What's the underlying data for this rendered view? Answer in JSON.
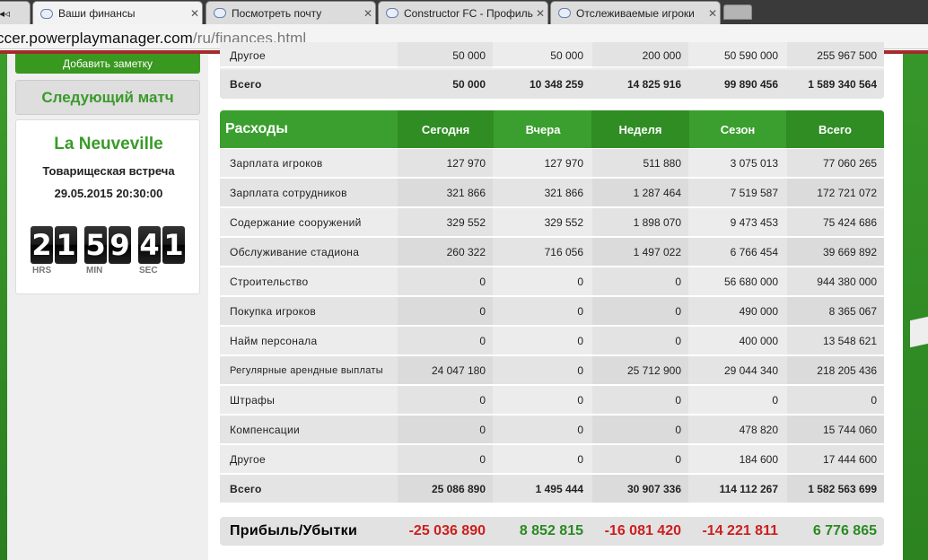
{
  "browser": {
    "tabs": [
      {
        "label": "Ваши финансы",
        "active": true
      },
      {
        "label": "Посмотреть почту",
        "active": false
      },
      {
        "label": "Constructor FC - Профиль",
        "active": false
      },
      {
        "label": "Отслеживаемые игроки",
        "active": false
      }
    ],
    "url_main": "ccer.powerplaymanager.com",
    "url_path": "/ru/finances.html"
  },
  "sidebar": {
    "add_note": "Добавить заметку",
    "next_match_title": "Следующий матч",
    "team": "La Neuveville",
    "match_type": "Товарищеская встреча",
    "match_date": "29.05.2015 20:30:00",
    "countdown": {
      "hours": [
        "2",
        "1"
      ],
      "minutes": [
        "5",
        "9"
      ],
      "seconds": [
        "4",
        "1"
      ],
      "hrs_label": "HRS",
      "min_label": "MIN",
      "sec_label": "SEC"
    }
  },
  "income_tail": {
    "other": {
      "label": "Другое",
      "values": [
        "50 000",
        "50 000",
        "200 000",
        "50 590 000",
        "255 967 500"
      ]
    },
    "total": {
      "label": "Всего",
      "values": [
        "50 000",
        "10 348 259",
        "14 825 916",
        "99 890 456",
        "1 589 340 564"
      ]
    }
  },
  "expenses": {
    "title": "Расходы",
    "columns": [
      "Сегодня",
      "Вчера",
      "Неделя",
      "Сезон",
      "Всего"
    ],
    "rows": [
      {
        "label": "Зарплата игроков",
        "values": [
          "127 970",
          "127 970",
          "511 880",
          "3 075 013",
          "77 060 265"
        ]
      },
      {
        "label": "Зарплата сотрудников",
        "values": [
          "321 866",
          "321 866",
          "1 287 464",
          "7 519 587",
          "172 721 072"
        ]
      },
      {
        "label": "Содержание сооружений",
        "values": [
          "329 552",
          "329 552",
          "1 898 070",
          "9 473 453",
          "75 424 686"
        ]
      },
      {
        "label": "Обслуживание стадиона",
        "values": [
          "260 322",
          "716 056",
          "1 497 022",
          "6 766 454",
          "39 669 892"
        ]
      },
      {
        "label": "Строительство",
        "values": [
          "0",
          "0",
          "0",
          "56 680 000",
          "944 380 000"
        ]
      },
      {
        "label": "Покупка игроков",
        "values": [
          "0",
          "0",
          "0",
          "490 000",
          "8 365 067"
        ]
      },
      {
        "label": "Найм персонала",
        "values": [
          "0",
          "0",
          "0",
          "400 000",
          "13 548 621"
        ]
      },
      {
        "label": "Регулярные арендные выплаты",
        "values": [
          "24 047 180",
          "0",
          "25 712 900",
          "29 044 340",
          "218 205 436"
        ]
      },
      {
        "label": "Штрафы",
        "values": [
          "0",
          "0",
          "0",
          "0",
          "0"
        ]
      },
      {
        "label": "Компенсации",
        "values": [
          "0",
          "0",
          "0",
          "478 820",
          "15 744 060"
        ]
      },
      {
        "label": "Другое",
        "values": [
          "0",
          "0",
          "0",
          "184 600",
          "17 444 600"
        ]
      }
    ],
    "total": {
      "label": "Всего",
      "values": [
        "25 086 890",
        "1 495 444",
        "30 907 336",
        "114 112 267",
        "1 582 563 699"
      ]
    }
  },
  "profit": {
    "label": "Прибыль/Убытки",
    "values": [
      "-25 036 890",
      "8 852 815",
      "-16 081 420",
      "-14 221 811",
      "6 776 865"
    ],
    "signs": [
      "neg",
      "pos",
      "neg",
      "neg",
      "pos"
    ]
  },
  "colors": {
    "accent_green": "#3a9f2e",
    "loss_red": "#cc1f1f",
    "profit_green": "#2a8a22"
  }
}
